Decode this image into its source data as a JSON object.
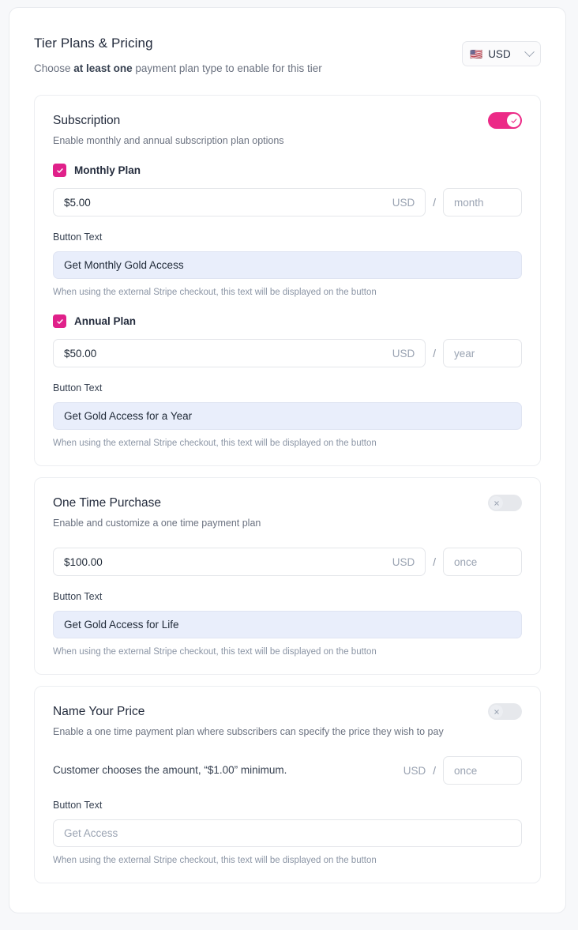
{
  "header": {
    "title": "Tier Plans & Pricing",
    "subtitle_pre": "Choose ",
    "subtitle_bold": "at least one",
    "subtitle_post": " payment plan type to enable for this tier",
    "currency": {
      "flag": "🇺🇸",
      "label": "USD",
      "chevron_icon": "chevron-down-icon"
    }
  },
  "common": {
    "button_text_label": "Button Text",
    "button_text_help": "When using the external Stripe checkout, this text will be displayed on the button",
    "currency_suffix": "USD",
    "separator": "/"
  },
  "sections": {
    "subscription": {
      "title": "Subscription",
      "desc": "Enable monthly and annual subscription plan options",
      "toggle_state": "on",
      "toggle_icon": "check-icon",
      "monthly": {
        "checkbox_label": "Monthly Plan",
        "checked": true,
        "price_value": "$5.00",
        "currency": "USD",
        "period_placeholder": "month",
        "button_text_value": "Get Monthly Gold Access"
      },
      "annual": {
        "checkbox_label": "Annual Plan",
        "checked": true,
        "price_value": "$50.00",
        "currency": "USD",
        "period_placeholder": "year",
        "button_text_value": "Get Gold Access for a Year"
      }
    },
    "one_time": {
      "title": "One Time Purchase",
      "desc": "Enable and customize a one time payment plan",
      "toggle_state": "off",
      "toggle_icon": "close-icon",
      "price_value": "$100.00",
      "currency": "USD",
      "period_placeholder": "once",
      "button_text_value": "Get Gold Access for Life"
    },
    "name_your_price": {
      "title": "Name Your Price",
      "desc": "Enable a one time payment plan where subscribers can specify the price they wish to pay",
      "toggle_state": "off",
      "toggle_icon": "close-icon",
      "customer_text": "Customer chooses the amount, “$1.00” minimum.",
      "currency": "USD",
      "period_placeholder": "once",
      "button_text_placeholder": "Get Access"
    }
  },
  "colors": {
    "accent_pink": "#e0218a",
    "toggle_on": "#ec2a87",
    "button_field_bg": "#e9eefb",
    "page_bg": "#f7f8fa"
  }
}
